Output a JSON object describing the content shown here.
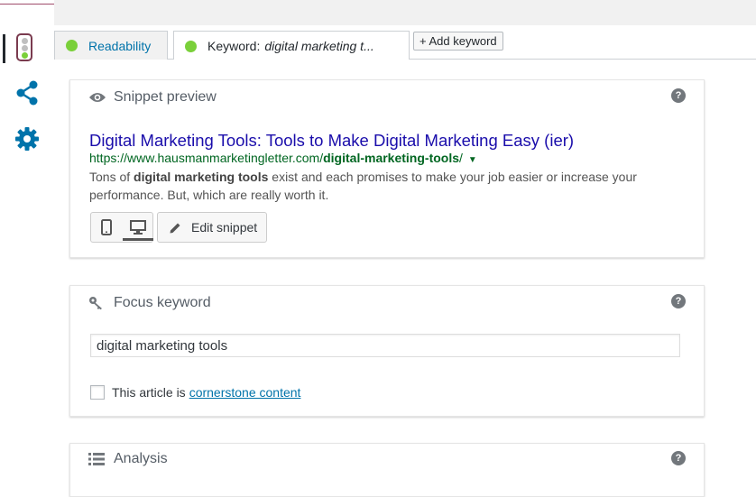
{
  "colors": {
    "accent_link": "#0073aa",
    "status_good": "#7ad03a",
    "snippet_title": "#1a0dab",
    "snippet_url": "#006621",
    "icon_blue": "#0073aa"
  },
  "rail": {
    "items": [
      {
        "name": "traffic-light-icon",
        "active": true
      },
      {
        "name": "share-icon"
      },
      {
        "name": "gear-icon"
      }
    ]
  },
  "tabs": {
    "readability_label": "Readability",
    "keyword_prefix": "Keyword:",
    "keyword_value": "digital marketing t...",
    "add_keyword_label": "+ Add keyword"
  },
  "snippet": {
    "section_title": "Snippet preview",
    "help": "?",
    "title": "Digital Marketing Tools: Tools to Make Digital Marketing Easy (ier)",
    "url_prefix": "https://www.hausmanmarketingletter.com/",
    "url_slug": "digital-marketing-tools",
    "url_suffix": "/",
    "url_caret": "▼",
    "desc_pre": "Tons of ",
    "desc_bold": "digital marketing tools",
    "desc_post": " exist and each promises to make your job easier or increase your performance. But, which are really worth it.",
    "edit_label": "Edit snippet",
    "mode": "desktop"
  },
  "focus": {
    "section_title": "Focus keyword",
    "help": "?",
    "keyword_value": "digital marketing tools",
    "cornerstone_prefix": "This article is",
    "cornerstone_link": "cornerstone content"
  },
  "analysis": {
    "section_title": "Analysis",
    "help": "?"
  }
}
